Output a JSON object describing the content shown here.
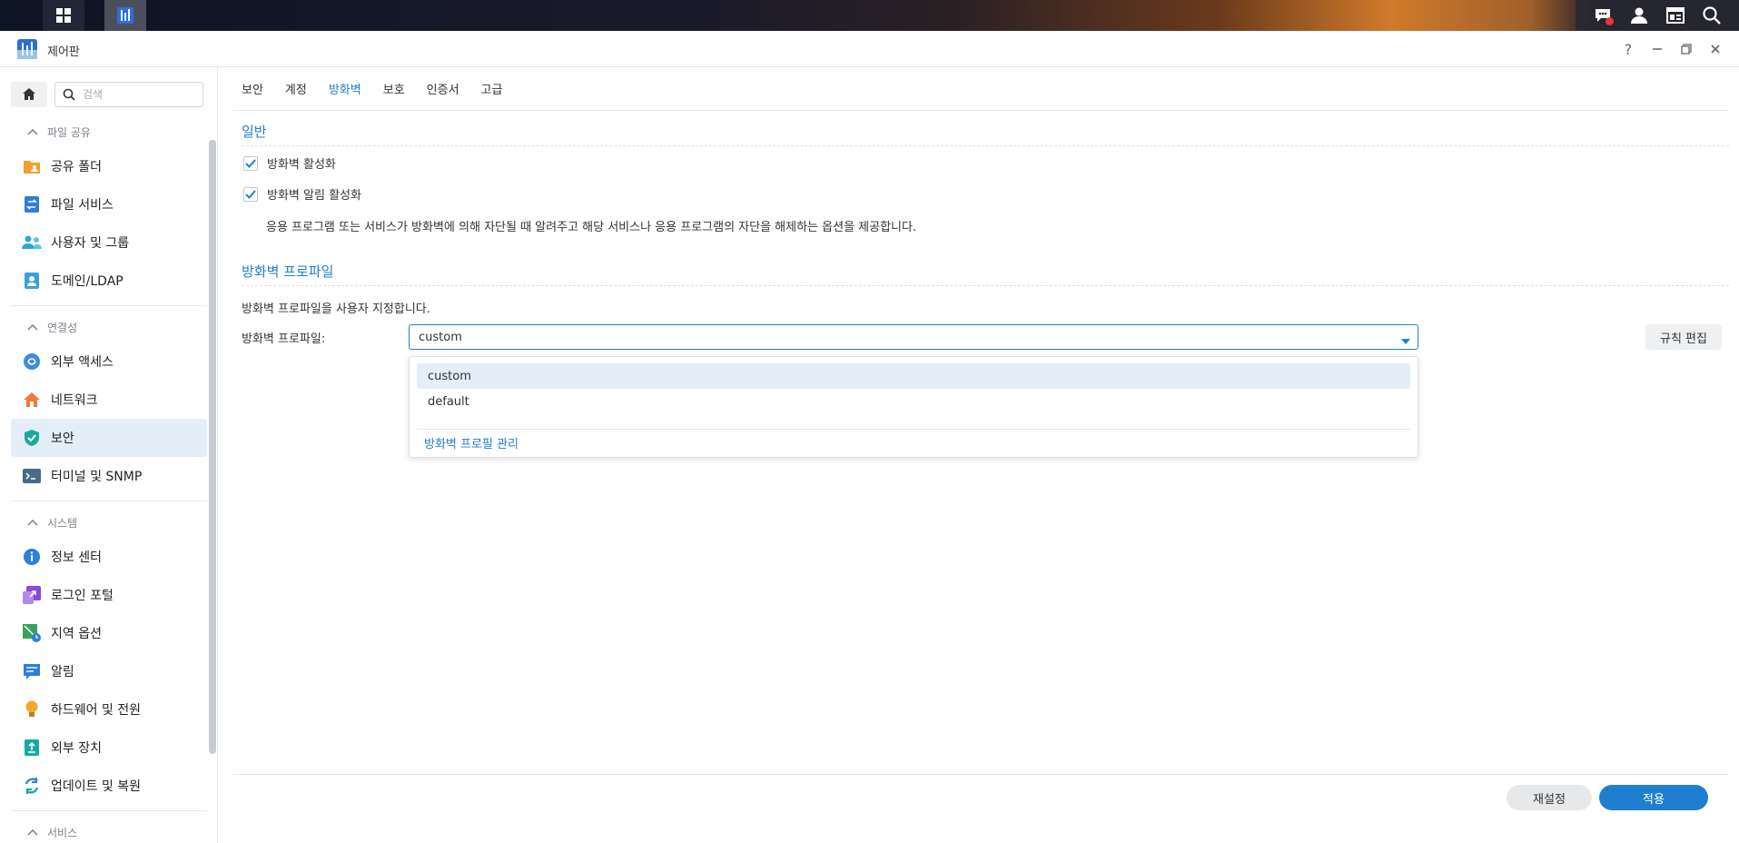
{
  "window": {
    "title": "제어판"
  },
  "sidebar": {
    "search_placeholder": "검색",
    "sections": [
      {
        "label": "파일 공유",
        "items": [
          "공유 폴더",
          "파일 서비스",
          "사용자 및 그룹",
          "도메인/LDAP"
        ]
      },
      {
        "label": "연결성",
        "items": [
          "외부 액세스",
          "네트워크",
          "보안",
          "터미널 및 SNMP"
        ]
      },
      {
        "label": "시스템",
        "items": [
          "정보 센터",
          "로그인 포털",
          "지역 옵션",
          "알림",
          "하드웨어 및 전원",
          "외부 장치",
          "업데이트 및 복원"
        ]
      },
      {
        "label": "서비스",
        "items": []
      }
    ],
    "selected": "보안"
  },
  "tabs": [
    "보안",
    "계정",
    "방화벽",
    "보호",
    "인증서",
    "고급"
  ],
  "active_tab": "방화벽",
  "general": {
    "title": "일반",
    "enable_firewall": "방화벽 활성화",
    "enable_notifications": "방화벽 알림 활성화",
    "notification_desc": "응용 프로그램 또는 서비스가 방화벽에 의해 자단될 때 알려주고 해당 서비스나 응용 프로그램의 자단을 해제하는 옵션을 제공합니다."
  },
  "profile": {
    "title": "방화벽 프로파일",
    "desc": "방화벽 프로파일을 사용자 지정합니다.",
    "label": "방화벽 프로파일:",
    "value": "custom",
    "edit_rules": "규칙 편집",
    "options": [
      "custom",
      "default"
    ],
    "manage_link": "방화벽 프로필 관리"
  },
  "footer": {
    "reset": "재설정",
    "apply": "적용"
  },
  "colors": {
    "accent": "#1f7ed0",
    "selected_bg": "#e4eef9"
  }
}
